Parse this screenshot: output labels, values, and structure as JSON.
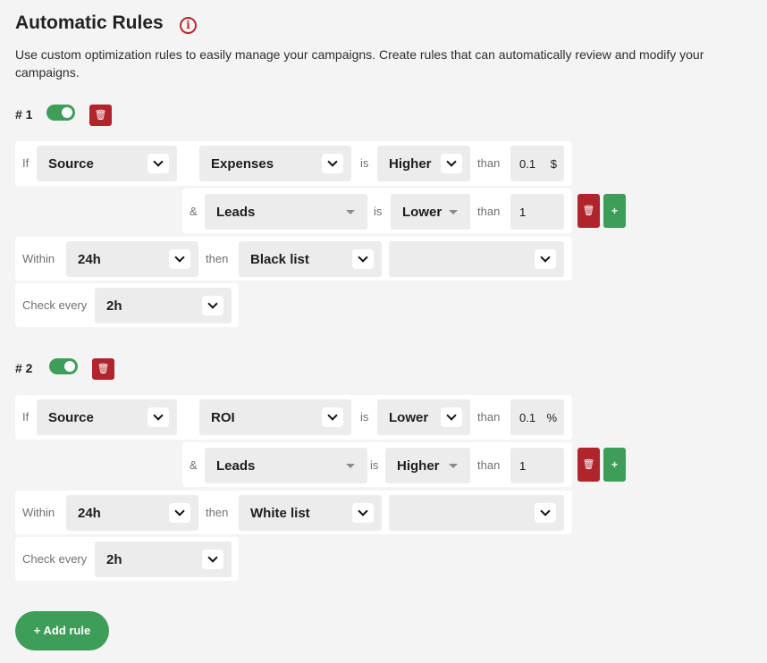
{
  "header": {
    "title": "Automatic Rules",
    "info_icon": "info-icon",
    "description": "Use custom optimization rules to easily manage your campaigns. Create rules that can automatically review and modify your campaigns."
  },
  "labels": {
    "if": "If",
    "is": "is",
    "than": "than",
    "and": "&",
    "within": "Within",
    "then": "then",
    "check_every": "Check every"
  },
  "rules": [
    {
      "number": "# 1",
      "enabled": true,
      "condition1": {
        "entity": "Source",
        "metric": "Expenses",
        "comparator": "Higher",
        "value": "0.1",
        "unit": "$"
      },
      "condition2": {
        "metric": "Leads",
        "comparator": "Lower",
        "value": "1"
      },
      "within": "24h",
      "action": "Black list",
      "action_target": "",
      "check_every": "2h"
    },
    {
      "number": "# 2",
      "enabled": true,
      "condition1": {
        "entity": "Source",
        "metric": "ROI",
        "comparator": "Lower",
        "value": "0.1",
        "unit": "%"
      },
      "condition2": {
        "metric": "Leads",
        "comparator": "Higher",
        "value": "1"
      },
      "within": "24h",
      "action": "White list",
      "action_target": "",
      "check_every": "2h"
    }
  ],
  "add_rule_label": "+ Add rule",
  "icons": {
    "trash": "trash-icon",
    "plus": "plus-icon",
    "chevron": "chevron-down-icon"
  },
  "colors": {
    "accent_green": "#3f9d5a",
    "danger_red": "#b0252c",
    "background": "#f4f4f4"
  }
}
